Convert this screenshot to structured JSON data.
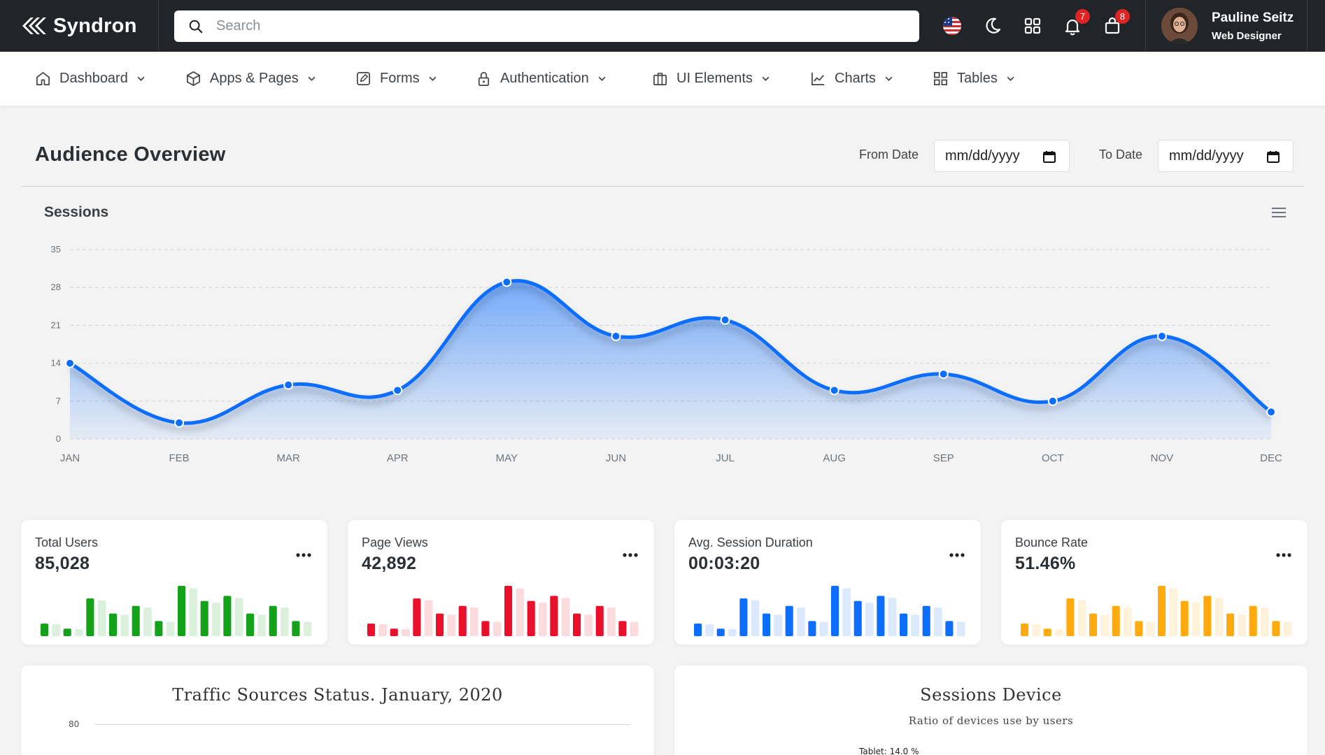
{
  "app": {
    "brand": "Syndron"
  },
  "search": {
    "placeholder": "Search"
  },
  "topbar": {
    "notifications_count": "7",
    "cart_count": "8"
  },
  "user": {
    "name": "Pauline Seitz",
    "role": "Web Designer"
  },
  "nav": {
    "items": [
      {
        "label": "Dashboard",
        "icon": "home-icon"
      },
      {
        "label": "Apps & Pages",
        "icon": "cube-icon"
      },
      {
        "label": "Forms",
        "icon": "edit-icon"
      },
      {
        "label": "Authentication",
        "icon": "lock-icon"
      },
      {
        "label": "UI Elements",
        "icon": "briefcase-icon"
      },
      {
        "label": "Charts",
        "icon": "line-chart-icon"
      },
      {
        "label": "Tables",
        "icon": "grid-icon"
      }
    ]
  },
  "page": {
    "title": "Audience Overview",
    "from_label": "From Date",
    "to_label": "To Date",
    "date_placeholder": "mm/dd/yyyy"
  },
  "sessions": {
    "title": "Sessions"
  },
  "chart_data": {
    "type": "area",
    "title": "Sessions",
    "categories": [
      "JAN",
      "FEB",
      "MAR",
      "APR",
      "MAY",
      "JUN",
      "JUL",
      "AUG",
      "SEP",
      "OCT",
      "NOV",
      "DEC"
    ],
    "series": [
      {
        "values": [
          14,
          3,
          10,
          9,
          29,
          19,
          22,
          9,
          12,
          7,
          19,
          5
        ]
      }
    ],
    "yticks": [
      "0",
      "7",
      "14",
      "21",
      "28",
      "35"
    ],
    "ylim": [
      0,
      35
    ],
    "grid": true,
    "color": "#0d6efd"
  },
  "stats": [
    {
      "label": "Total Users",
      "value": "85,028",
      "color": "#15a21b",
      "bars": [
        0.25,
        0.15,
        0.75,
        0.45,
        0.6,
        0.3,
        1.0,
        0.7,
        0.8,
        0.45,
        0.6,
        0.3
      ]
    },
    {
      "label": "Page Views",
      "value": "42,892",
      "color": "#e8102a",
      "bars": [
        0.25,
        0.15,
        0.75,
        0.45,
        0.6,
        0.3,
        1.0,
        0.7,
        0.8,
        0.45,
        0.6,
        0.3
      ]
    },
    {
      "label": "Avg. Session Duration",
      "value": "00:03:20",
      "color": "#0d6efd",
      "bars": [
        0.25,
        0.15,
        0.75,
        0.45,
        0.6,
        0.3,
        1.0,
        0.7,
        0.8,
        0.45,
        0.6,
        0.3
      ]
    },
    {
      "label": "Bounce Rate",
      "value": "51.46%",
      "color": "#ffab10",
      "bars": [
        0.25,
        0.15,
        0.75,
        0.45,
        0.6,
        0.3,
        1.0,
        0.7,
        0.8,
        0.45,
        0.6,
        0.3
      ]
    }
  ],
  "traffic": {
    "title": "Traffic Sources Status. January, 2020",
    "tick": "80"
  },
  "devices": {
    "title": "Sessions Device",
    "subtitle": "Ratio of devices use by users",
    "legend": "Tablet: 14.0 %"
  }
}
